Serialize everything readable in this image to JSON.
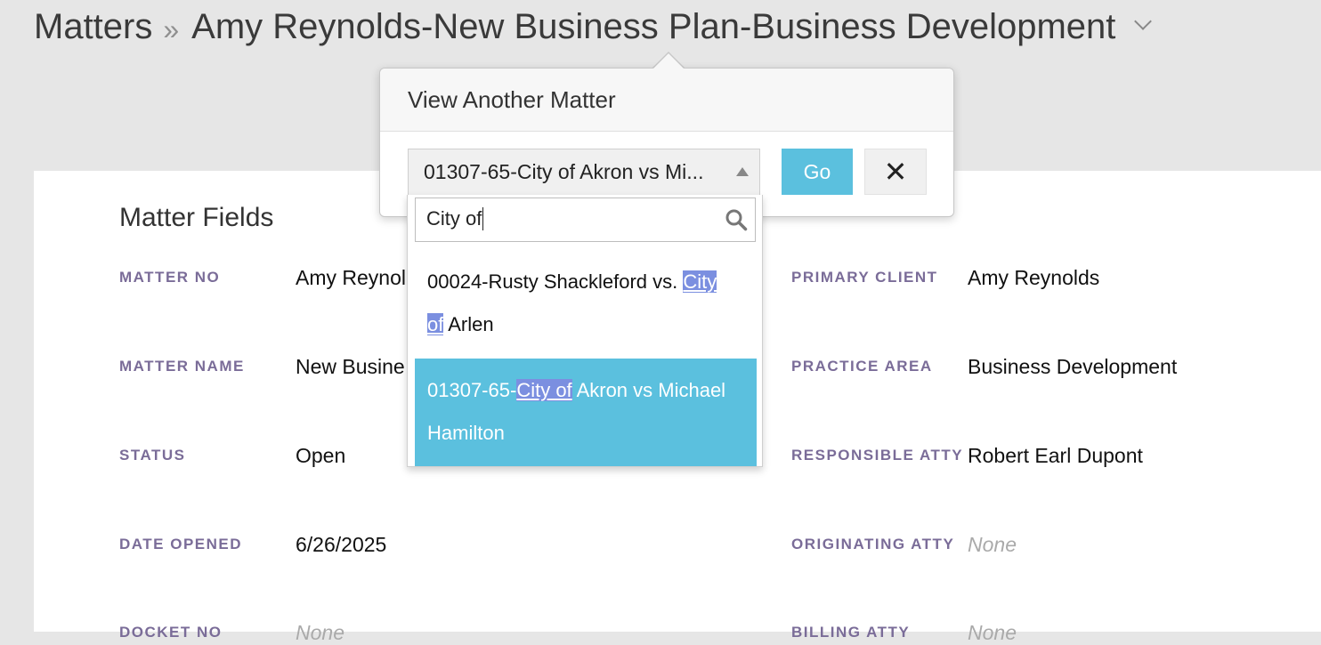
{
  "breadcrumb": {
    "root": "Matters",
    "separator": "»",
    "current": "Amy Reynolds-New Business Plan-Business Development"
  },
  "section": {
    "title": "Matter Fields"
  },
  "fields_left": [
    {
      "label": "MATTER NO",
      "value": "Amy Reynol"
    },
    {
      "label": "MATTER NAME",
      "value": "New Busine"
    },
    {
      "label": "STATUS",
      "value": "Open"
    },
    {
      "label": "DATE OPENED",
      "value": "6/26/2025"
    },
    {
      "label": "DOCKET NO",
      "value": "None"
    }
  ],
  "fields_right": [
    {
      "label": "PRIMARY CLIENT",
      "value": "Amy Reynolds"
    },
    {
      "label": "PRACTICE AREA",
      "value": "Business Development"
    },
    {
      "label": "RESPONSIBLE ATTY",
      "value": "Robert Earl Dupont"
    },
    {
      "label": "ORIGINATING ATTY",
      "value": "None"
    },
    {
      "label": "BILLING ATTY",
      "value": "None"
    }
  ],
  "popover": {
    "title": "View Another Matter",
    "selected_value": "01307-65-City of Akron vs Mi...",
    "go_label": "Go",
    "close_label": "✕"
  },
  "dropdown": {
    "search_text": "City of",
    "options": [
      {
        "before": "00024-Rusty Shackleford vs. ",
        "match1": "City",
        "mid": "",
        "match2": "of",
        "after": " Arlen"
      },
      {
        "before": "01307-65-",
        "match1": "City of",
        "mid": "",
        "match2": "",
        "after": " Akron vs Michael Hamilton"
      }
    ]
  },
  "colors": {
    "accent": "#5bc0de",
    "label": "#7a6c98",
    "highlight": "#7b8fe0"
  }
}
